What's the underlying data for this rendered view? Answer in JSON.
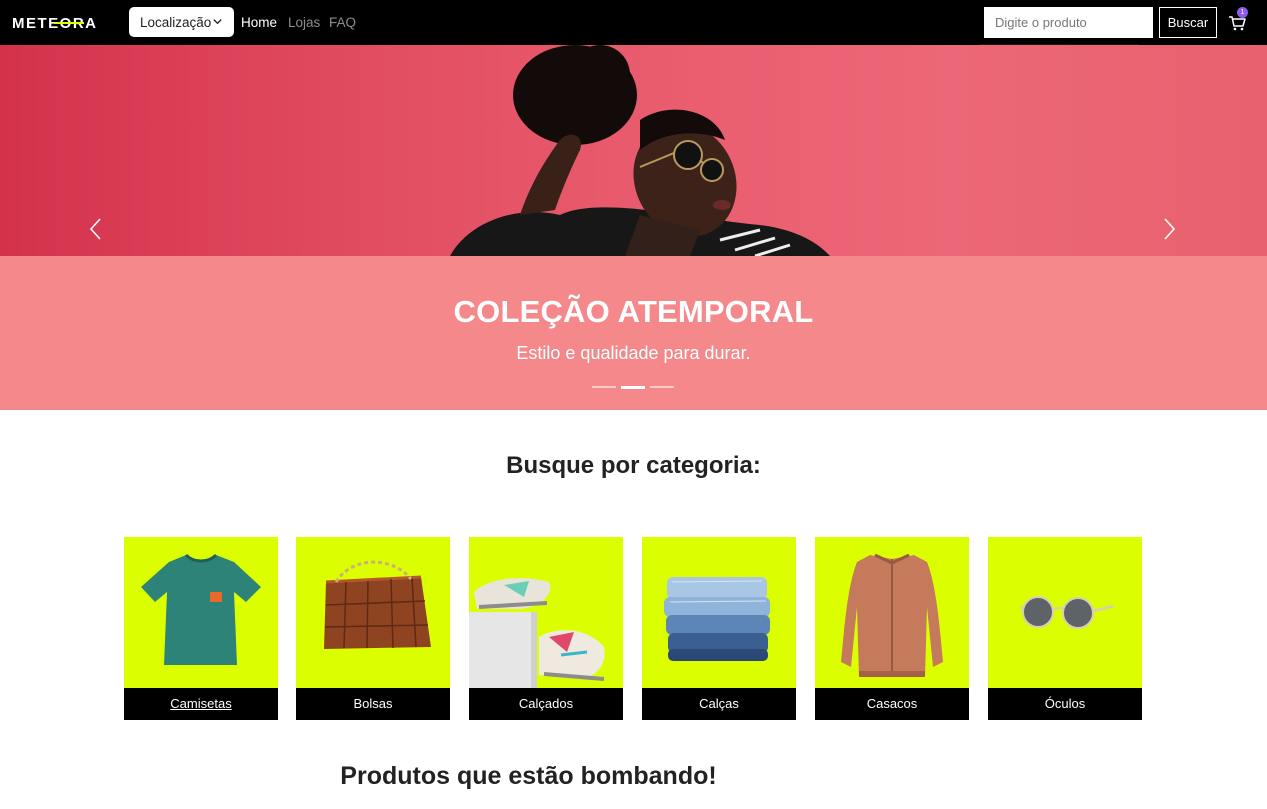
{
  "brand": {
    "logo_text": "METEORA",
    "accent_color": "#dcff00"
  },
  "nav": {
    "location_label": "Localização",
    "links": [
      "Home",
      "Lojas",
      "FAQ"
    ],
    "search_placeholder": "Digite o produto",
    "search_button": "Buscar",
    "cart_count": "1"
  },
  "hero": {
    "title": "COLEÇÃO ATEMPORAL",
    "subtitle": "Estilo e qualidade para durar.",
    "active_slide": 2,
    "slide_count": 3
  },
  "categories": {
    "title": "Busque por categoria:",
    "items": [
      {
        "label": "Camisetas",
        "icon": "tshirt-image"
      },
      {
        "label": "Bolsas",
        "icon": "bag-image"
      },
      {
        "label": "Calçados",
        "icon": "sneakers-image"
      },
      {
        "label": "Calças",
        "icon": "jeans-image"
      },
      {
        "label": "Casacos",
        "icon": "jacket-image"
      },
      {
        "label": "Óculos",
        "icon": "glasses-image"
      }
    ]
  },
  "trending": {
    "title": "Produtos que estão bombando!"
  }
}
